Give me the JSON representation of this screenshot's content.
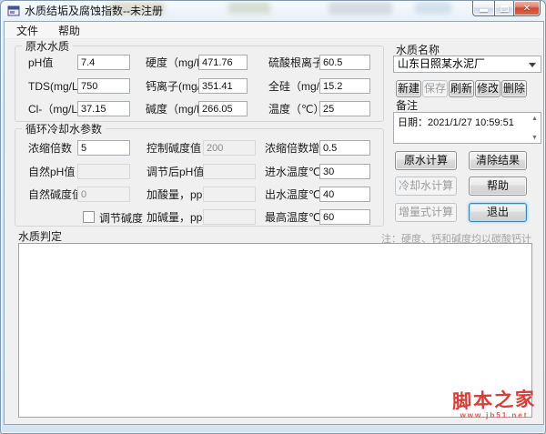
{
  "window": {
    "title": "水质结垢及腐蚀指数--未注册"
  },
  "menu": {
    "file": "文件",
    "help": "帮助"
  },
  "icons": {
    "close": "✕",
    "dropdown": "▼",
    "scroll_up": "▲",
    "scroll_down": "▼"
  },
  "raw_water": {
    "title": "原水水质",
    "fields": [
      {
        "label": "pH值",
        "value": "7.4"
      },
      {
        "label": "硬度（mg/L）",
        "value": "471.76"
      },
      {
        "label": "硫酸根离子",
        "value": "60.5"
      },
      {
        "label": "TDS(mg/L)",
        "value": "750"
      },
      {
        "label": "钙离子(mg/L)",
        "value": "351.41"
      },
      {
        "label": "全硅（mg/L）",
        "value": "15.2"
      },
      {
        "label": "Cl-（mg/L）",
        "value": "37.15"
      },
      {
        "label": "碱度（mg/L）",
        "value": "266.05"
      },
      {
        "label": "温度（℃）",
        "value": "25"
      }
    ]
  },
  "cooling_water": {
    "title": "循环冷却水参数",
    "checkbox_label": "调节碱度",
    "fields": [
      {
        "label": "浓缩倍数",
        "value": "5"
      },
      {
        "label": "控制碱度值",
        "value": "200"
      },
      {
        "label": "浓缩倍数增幅",
        "value": "0.5"
      },
      {
        "label": "自然pH值",
        "value": ""
      },
      {
        "label": "调节后pH值",
        "value": ""
      },
      {
        "label": "进水温度℃",
        "value": "30"
      },
      {
        "label": "自然碱度值",
        "value": "0"
      },
      {
        "label": "加酸量，ppm",
        "value": ""
      },
      {
        "label": "出水温度℃",
        "value": "40"
      },
      {
        "label": "加碱量，ppm",
        "value": ""
      },
      {
        "label": "最高温度℃",
        "value": "60"
      }
    ]
  },
  "water_name": {
    "title": "水质名称",
    "selected": "山东日照某水泥厂",
    "buttons": [
      "新建",
      "保存",
      "刷新",
      "修改",
      "删除"
    ]
  },
  "remark": {
    "title": "备注",
    "text": "日期：2021/1/27 10:59:51"
  },
  "actions": {
    "raw_calc": "原水计算",
    "clear": "清除结果",
    "cooling_calc": "冷却水计算",
    "help": "帮助",
    "incremental_calc": "增量式计算",
    "exit": "退出"
  },
  "judgement": {
    "title": "水质判定",
    "note": "注：硬度、钙和碱度均以碳酸钙计",
    "content": ""
  },
  "watermark": {
    "name": "脚本之家",
    "url": "www.jb51.net"
  },
  "colors": {
    "accent_focus": "#2c8ac9",
    "close_red": "#cc4a35",
    "watermark_red": "#dd3b35",
    "client_bg": "#f0f0f0"
  }
}
